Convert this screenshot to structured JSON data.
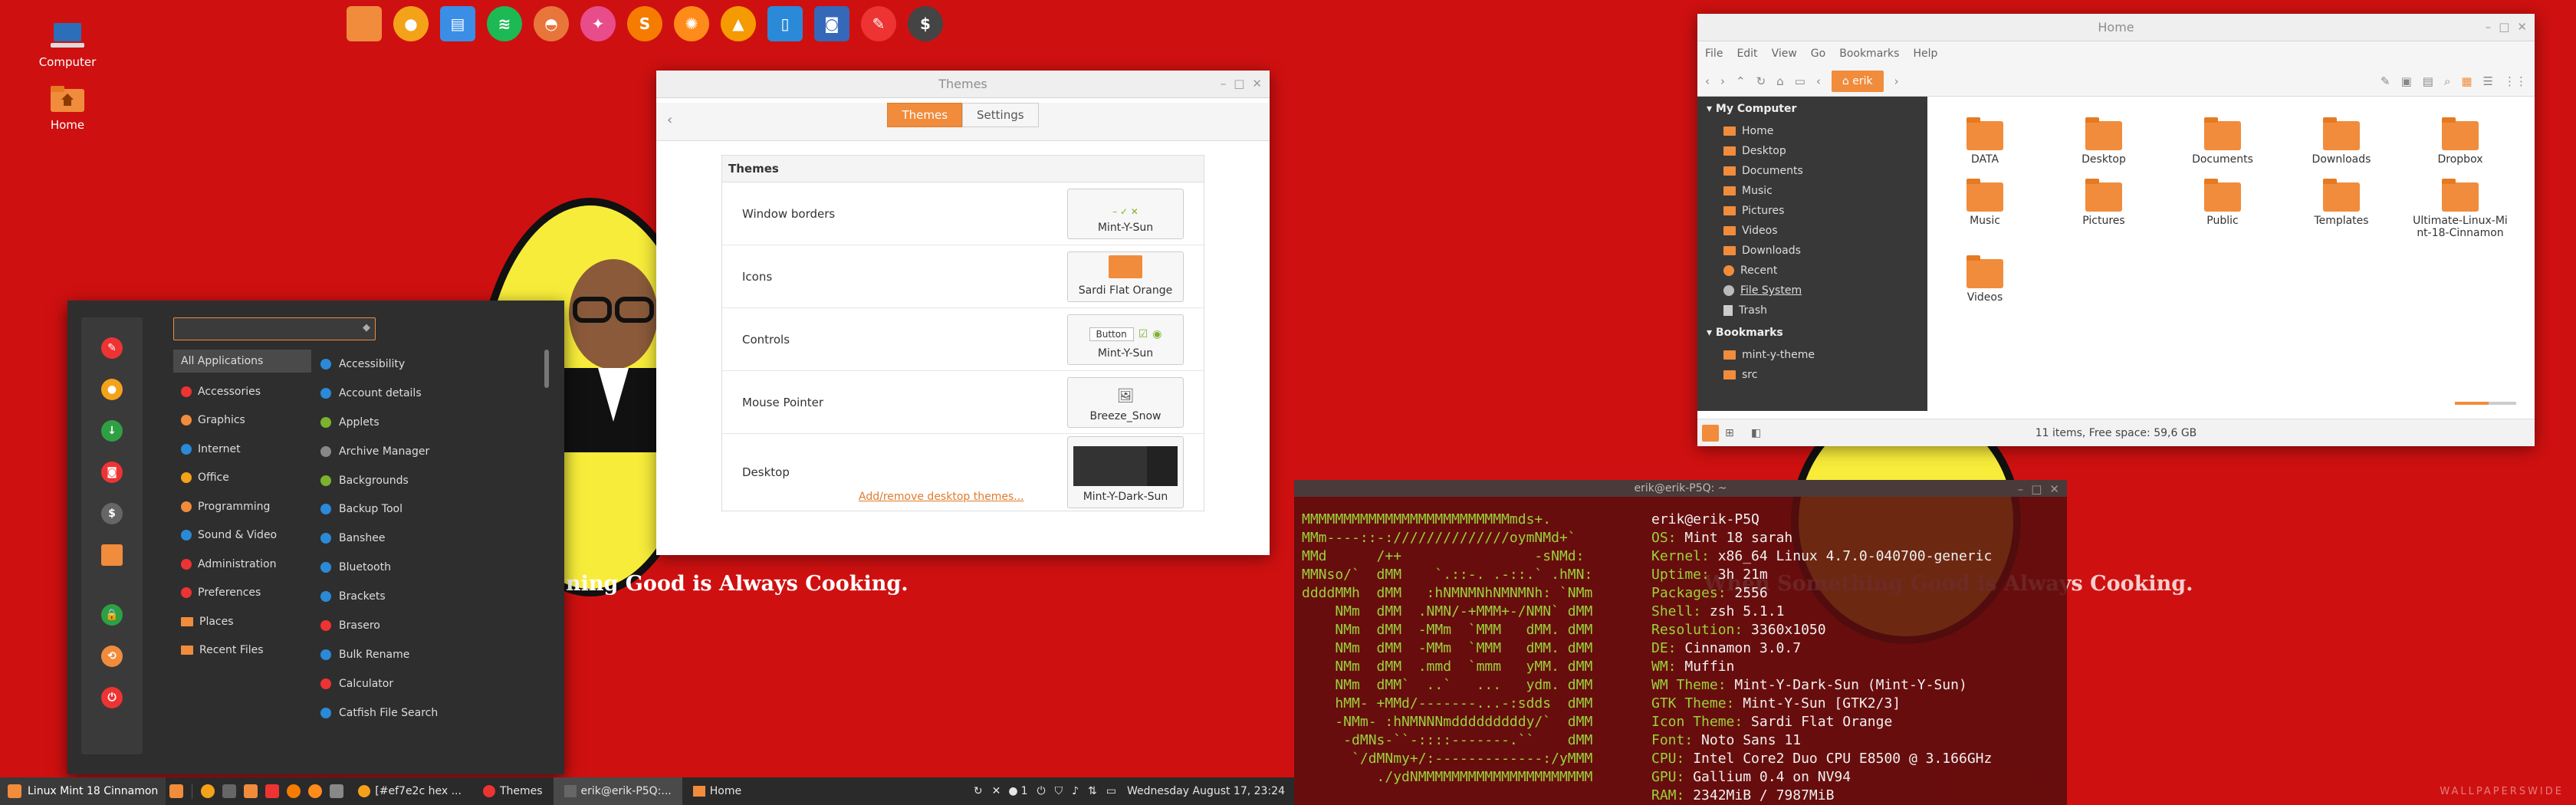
{
  "desktop": {
    "icons": [
      {
        "label": "Computer",
        "icon": "computer-icon"
      },
      {
        "label": "Home",
        "icon": "home-folder-icon"
      }
    ],
    "wallpaper_text_left": "ning Good is Always Cooking.",
    "wallpaper_text_right": "When Something Good is Always Cooking.",
    "watermark": "WALLPAPERSWIDE"
  },
  "dock": [
    "files",
    "firefox",
    "docs",
    "spotify",
    "bread",
    "hexchat",
    "sublime",
    "orange",
    "vlc",
    "note",
    "screenshot",
    "mint",
    "terminal"
  ],
  "themes_window": {
    "title": "Themes",
    "tabs": [
      {
        "label": "Themes",
        "active": true
      },
      {
        "label": "Settings",
        "active": false
      }
    ],
    "panel_heading": "Themes",
    "rows": [
      {
        "label": "Window borders",
        "value": "Mint-Y-Sun"
      },
      {
        "label": "Icons",
        "value": "Sardi Flat Orange"
      },
      {
        "label": "Controls",
        "value": "Mint-Y-Sun",
        "preview_button": "Button"
      },
      {
        "label": "Mouse Pointer",
        "value": "Breeze_Snow"
      },
      {
        "label": "Desktop",
        "value": "Mint-Y-Dark-Sun"
      }
    ],
    "add_remove_link": "Add/remove desktop themes..."
  },
  "nemo": {
    "title": "Home",
    "menu": [
      "File",
      "Edit",
      "View",
      "Go",
      "Bookmarks",
      "Help"
    ],
    "crumb": "erik",
    "sidebar": {
      "my_computer": "My Computer",
      "places": [
        "Home",
        "Desktop",
        "Documents",
        "Music",
        "Pictures",
        "Videos",
        "Downloads",
        "Recent",
        "File System",
        "Trash"
      ],
      "bookmarks": "Bookmarks",
      "bookmark_items": [
        "mint-y-theme",
        "src"
      ]
    },
    "files": [
      "DATA",
      "Desktop",
      "Documents",
      "Downloads",
      "Dropbox",
      "Music",
      "Pictures",
      "Public",
      "Templates",
      "Ultimate-Linux-Mint-18-Cinnamon",
      "Videos"
    ],
    "status": "11 items, Free space: 59,6 GB"
  },
  "terminal": {
    "title": "erik@erik-P5Q: ~",
    "art": [
      "MMMMMMMMMMMMMMMMMMMMMMMMMmds+.",
      "MMm----::-://////////////oymNMd+`",
      "MMd      /++                -sNMd:",
      "MMNso/`  dMM    `.::-. .-::.` .hMN:",
      "ddddMMh  dMM   :hNMNMNhNMNMNh: `NMm",
      "    NMm  dMM  .NMN/-+MMM+-/NMN` dMM",
      "    NMm  dMM  -MMm  `MMM   dMM. dMM",
      "    NMm  dMM  -MMm  `MMM   dMM. dMM",
      "    NMm  dMM  .mmd  `mmm   yMM. dMM",
      "    NMm  dMM`  ..`   ...   ydm. dMM",
      "    hMM- +MMd/-------...-:sdds  dMM",
      "    -NMm- :hNMNNNmdddddddddy/`  dMM",
      "     -dMNs-``-::::-------.``    dMM",
      "      `/dMNmy+/:-------------:/yMMM",
      "         ./ydNMMMMMMMMMMMMMMMMMMMMM"
    ],
    "info": [
      {
        "k": "",
        "v": "erik@erik-P5Q"
      },
      {
        "k": "OS:",
        "v": " Mint 18 sarah"
      },
      {
        "k": "Kernel:",
        "v": " x86_64 Linux 4.7.0-040700-generic"
      },
      {
        "k": "Uptime:",
        "v": " 3h 21m"
      },
      {
        "k": "Packages:",
        "v": " 2556"
      },
      {
        "k": "Shell:",
        "v": " zsh 5.1.1"
      },
      {
        "k": "Resolution:",
        "v": " 3360x1050"
      },
      {
        "k": "DE:",
        "v": " Cinnamon 3.0.7"
      },
      {
        "k": "WM:",
        "v": " Muffin"
      },
      {
        "k": "WM Theme:",
        "v": " Mint-Y-Dark-Sun (Mint-Y-Sun)"
      },
      {
        "k": "GTK Theme:",
        "v": " Mint-Y-Sun [GTK2/3]"
      },
      {
        "k": "Icon Theme:",
        "v": " Sardi Flat Orange"
      },
      {
        "k": "Font:",
        "v": " Noto Sans 11"
      },
      {
        "k": "CPU:",
        "v": " Intel Core2 Duo CPU E8500 @ 3.166GHz"
      },
      {
        "k": "GPU:",
        "v": " Gallium 0.4 on NV94"
      },
      {
        "k": "RAM:",
        "v": " 2342MiB / 7987MiB"
      }
    ]
  },
  "menu": {
    "categories": [
      "All Applications",
      "Accessories",
      "Graphics",
      "Internet",
      "Office",
      "Programming",
      "Sound & Video",
      "Administration",
      "Preferences",
      "Places",
      "Recent Files"
    ],
    "apps": [
      "Accessibility",
      "Account details",
      "Applets",
      "Archive Manager",
      "Backgrounds",
      "Backup Tool",
      "Banshee",
      "Bluetooth",
      "Brackets",
      "Brasero",
      "Bulk Rename",
      "Calculator",
      "Catfish File Search"
    ]
  },
  "taskbar": {
    "start_label": "Linux Mint 18 Cinnamon",
    "windows": [
      "[#ef7e2c hex ...",
      "Themes",
      "erik@erik-P5Q:...",
      "Home"
    ],
    "tray_text": "1",
    "clock": "Wednesday August 17, 23:24"
  }
}
